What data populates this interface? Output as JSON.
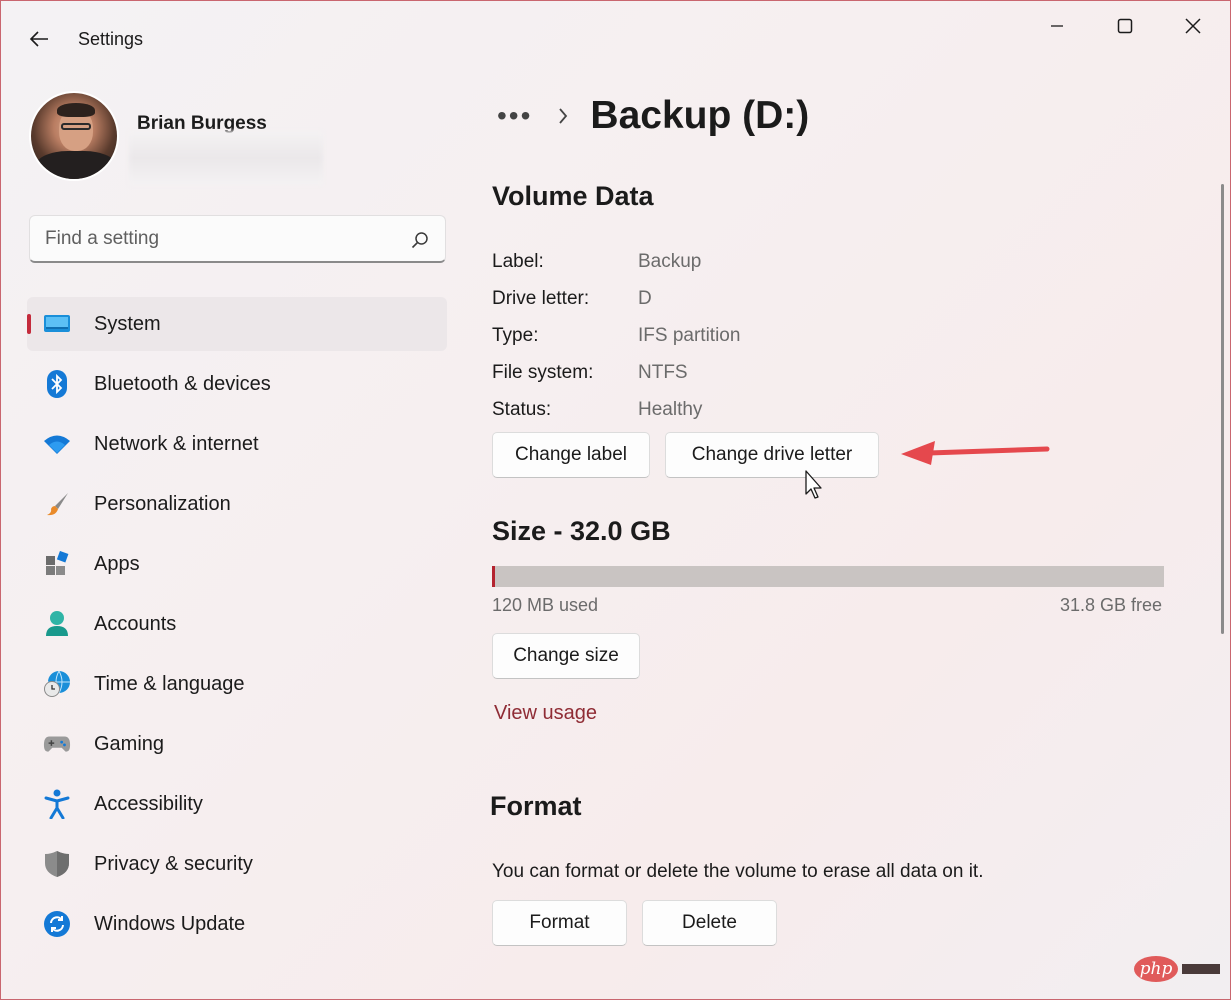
{
  "window": {
    "title": "Settings",
    "accent": "#c42b3c",
    "link_color": "#8f2c35"
  },
  "profile": {
    "name": "Brian Burgess"
  },
  "search": {
    "placeholder": "Find a setting",
    "icon": "search-icon"
  },
  "nav": {
    "items": [
      {
        "label": "System",
        "icon": "monitor-icon",
        "selected": true
      },
      {
        "label": "Bluetooth & devices",
        "icon": "bluetooth-icon"
      },
      {
        "label": "Network & internet",
        "icon": "wifi-icon"
      },
      {
        "label": "Personalization",
        "icon": "brush-icon"
      },
      {
        "label": "Apps",
        "icon": "apps-icon"
      },
      {
        "label": "Accounts",
        "icon": "person-icon"
      },
      {
        "label": "Time & language",
        "icon": "globe-clock-icon"
      },
      {
        "label": "Gaming",
        "icon": "gamepad-icon"
      },
      {
        "label": "Accessibility",
        "icon": "accessibility-icon"
      },
      {
        "label": "Privacy & security",
        "icon": "shield-icon"
      },
      {
        "label": "Windows Update",
        "icon": "update-icon"
      }
    ]
  },
  "breadcrumb": {
    "overflow": "•••",
    "title": "Backup (D:)"
  },
  "volume": {
    "heading": "Volume Data",
    "fields": [
      {
        "key": "Label:",
        "value": "Backup"
      },
      {
        "key": "Drive letter:",
        "value": "D"
      },
      {
        "key": "Type:",
        "value": "IFS partition"
      },
      {
        "key": "File system:",
        "value": "NTFS"
      },
      {
        "key": "Status:",
        "value": "Healthy"
      }
    ],
    "change_label_button": "Change label",
    "change_letter_button": "Change drive letter"
  },
  "size": {
    "heading": "Size - 32.0 GB",
    "used_label": "120 MB used",
    "free_label": "31.8 GB free",
    "used_fraction": 0.004,
    "change_size_button": "Change size",
    "view_usage_link": "View usage"
  },
  "format": {
    "heading": "Format",
    "description": "You can format or delete the volume to erase all data on it.",
    "format_button": "Format",
    "delete_button": "Delete"
  },
  "watermark": {
    "text": "php"
  }
}
